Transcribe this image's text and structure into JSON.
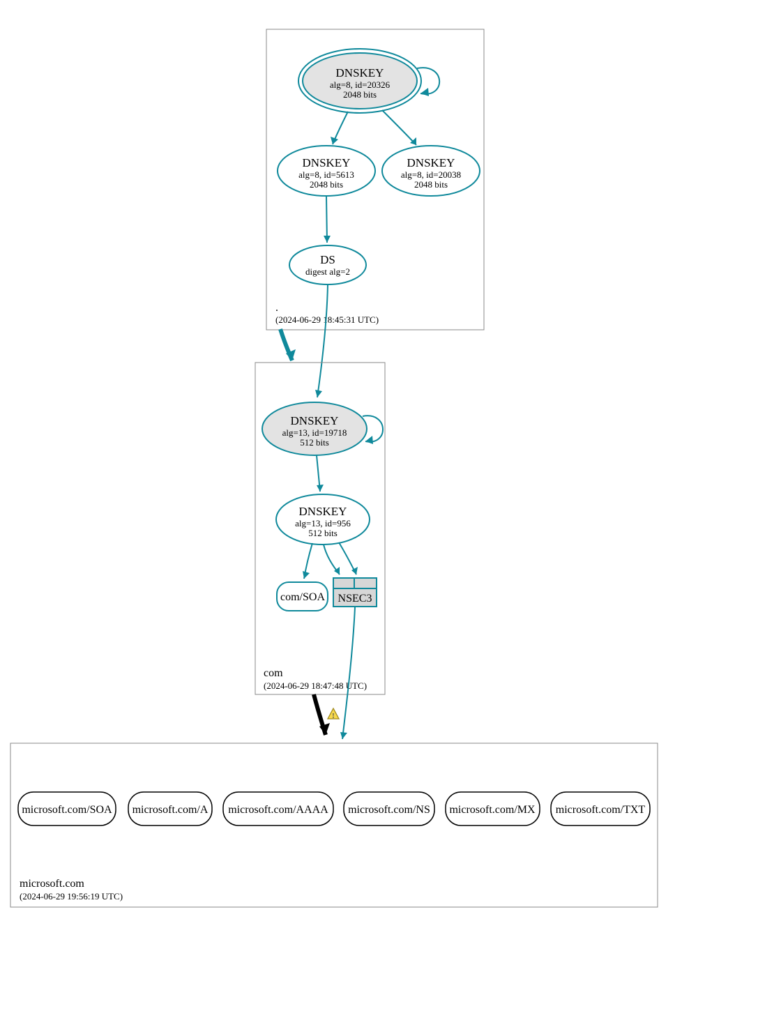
{
  "colors": {
    "teal": "#0f899b",
    "ksk_fill": "#e3e3e3",
    "nsec3_fill": "#d7d7d7",
    "warn_yellow": "#f7d94c",
    "warn_stroke": "#a08a1f"
  },
  "zones": {
    "root": {
      "name": ".",
      "timestamp": "(2024-06-29 18:45:31 UTC)",
      "nodes": {
        "ksk": {
          "title": "DNSKEY",
          "line2": "alg=8, id=20326",
          "line3": "2048 bits"
        },
        "zsk1": {
          "title": "DNSKEY",
          "line2": "alg=8, id=5613",
          "line3": "2048 bits"
        },
        "zsk2": {
          "title": "DNSKEY",
          "line2": "alg=8, id=20038",
          "line3": "2048 bits"
        },
        "ds": {
          "title": "DS",
          "line2": "digest alg=2"
        }
      }
    },
    "com": {
      "name": "com",
      "timestamp": "(2024-06-29 18:47:48 UTC)",
      "nodes": {
        "ksk": {
          "title": "DNSKEY",
          "line2": "alg=13, id=19718",
          "line3": "512 bits"
        },
        "zsk": {
          "title": "DNSKEY",
          "line2": "alg=13, id=956",
          "line3": "512 bits"
        },
        "soa": "com/SOA",
        "nsec3": "NSEC3"
      }
    },
    "microsoft": {
      "name": "microsoft.com",
      "timestamp": "(2024-06-29 19:56:19 UTC)",
      "records": [
        "microsoft.com/SOA",
        "microsoft.com/A",
        "microsoft.com/AAAA",
        "microsoft.com/NS",
        "microsoft.com/MX",
        "microsoft.com/TXT"
      ]
    }
  },
  "warning_icon": "!"
}
